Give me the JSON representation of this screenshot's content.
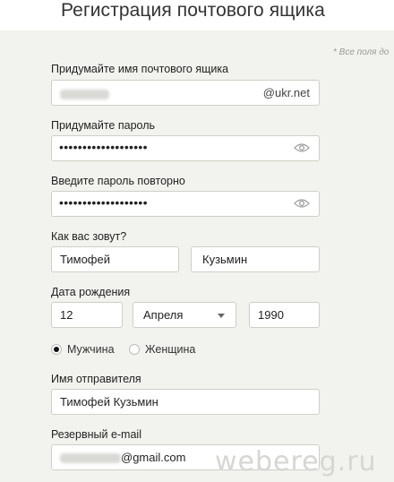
{
  "header": {
    "title": "Регистрация почтового ящика"
  },
  "required_note": "* Все поля до",
  "mailbox": {
    "label": "Придумайте имя почтового ящика",
    "domain": "@ukr.net"
  },
  "password": {
    "label": "Придумайте пароль",
    "value": "•••••••••••••••••••"
  },
  "password_repeat": {
    "label": "Введите пароль повторно",
    "value": "•••••••••••••••••••"
  },
  "name": {
    "label": "Как вас зовут?",
    "first": "Тимофей",
    "last": "Кузьмин"
  },
  "birth": {
    "label": "Дата рождения",
    "day": "12",
    "month": "Апреля",
    "year": "1990"
  },
  "gender": {
    "male": "Мужчина",
    "female": "Женщина",
    "selected": "male"
  },
  "sender": {
    "label": "Имя отправителя",
    "value": "Тимофей Кузьмин"
  },
  "backup_email": {
    "label": "Резервный e-mail",
    "domain": "@gmail.com"
  },
  "watermark": "webereg.ru"
}
